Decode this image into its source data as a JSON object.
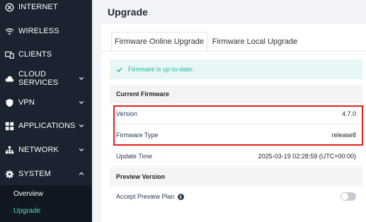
{
  "sidebar": {
    "items": [
      {
        "label": "INTERNET",
        "icon": "globe-icon"
      },
      {
        "label": "WIRELESS",
        "icon": "wifi-icon"
      },
      {
        "label": "CLIENTS",
        "icon": "devices-icon"
      },
      {
        "label": "CLOUD SERVICES",
        "icon": "cloud-icon"
      },
      {
        "label": "VPN",
        "icon": "shield-icon"
      },
      {
        "label": "APPLICATIONS",
        "icon": "apps-icon"
      },
      {
        "label": "NETWORK",
        "icon": "network-icon"
      },
      {
        "label": "SYSTEM",
        "icon": "gear-icon"
      }
    ],
    "submenu": [
      {
        "label": "Overview"
      },
      {
        "label": "Upgrade",
        "active": true
      }
    ]
  },
  "page": {
    "title": "Upgrade"
  },
  "tabs": [
    {
      "label": "Firmware Online Upgrade",
      "active": true
    },
    {
      "label": "Firmware Local Upgrade",
      "active": false
    }
  ],
  "alert": {
    "text": "Firmware is up-to-date."
  },
  "current_firmware": {
    "heading": "Current Firmware",
    "rows": [
      {
        "label": "Version",
        "value": "4.7.0"
      },
      {
        "label": "Firmware Type",
        "value": "release8"
      },
      {
        "label": "Update Time",
        "value": "2025-03-19 02:28:59 (UTC+00:00)"
      }
    ]
  },
  "preview": {
    "heading": "Preview Version",
    "accept_label": "Accept Preview Plan",
    "accept_enabled": false
  },
  "colors": {
    "sidebar_bg": "#1b2230",
    "accent": "#4fd3c4",
    "highlight": "#e81e1e"
  }
}
